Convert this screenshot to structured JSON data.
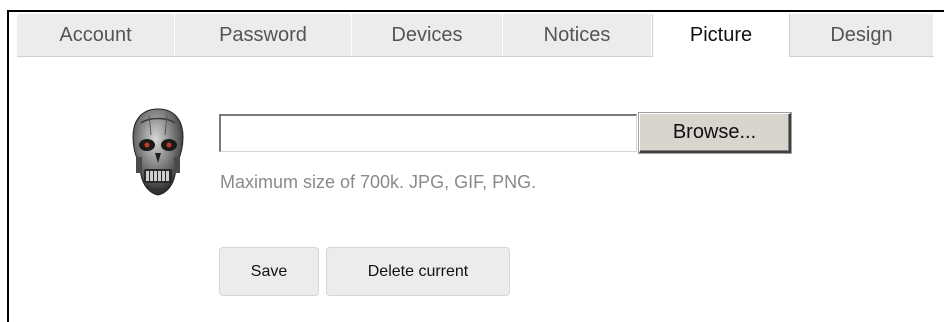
{
  "tabs": [
    {
      "label": "Account",
      "active": false
    },
    {
      "label": "Password",
      "active": false
    },
    {
      "label": "Devices",
      "active": false
    },
    {
      "label": "Notices",
      "active": false
    },
    {
      "label": "Picture",
      "active": true
    },
    {
      "label": "Design",
      "active": false
    }
  ],
  "upload": {
    "file_value": "",
    "browse_label": "Browse...",
    "hint": "Maximum size of 700k. JPG, GIF, PNG."
  },
  "actions": {
    "save_label": "Save",
    "delete_label": "Delete current"
  },
  "avatar": {
    "icon": "skull-avatar-icon",
    "colors": {
      "metal": "#8a8a8a",
      "dark": "#2a2a2a",
      "eye": "#c0392b"
    }
  }
}
